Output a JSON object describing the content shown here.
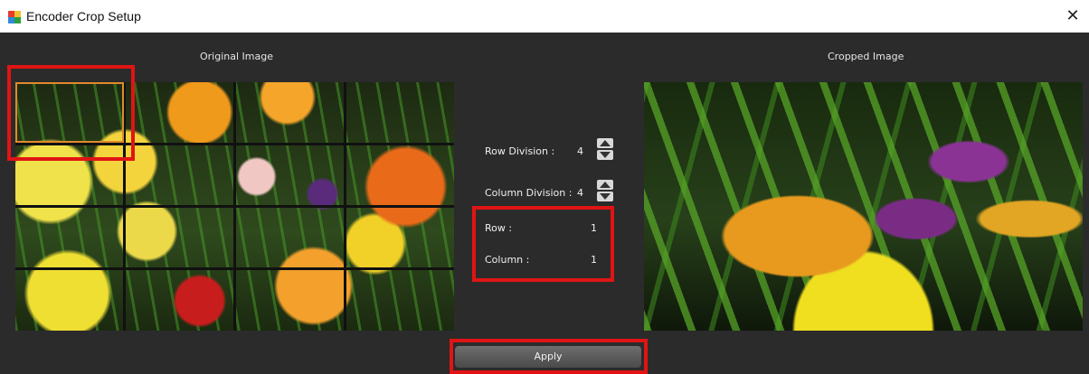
{
  "window": {
    "title": "Encoder Crop Setup",
    "close_glyph": "✕",
    "icon": "app-grid-icon",
    "icon_colors": [
      "#e63b2e",
      "#f2c12e",
      "#2f8ad8",
      "#2e9e3c"
    ]
  },
  "panels": {
    "original_label": "Original Image",
    "cropped_label": "Cropped Image"
  },
  "controls": {
    "row_division_label": "Row Division :",
    "row_division_value": "4",
    "column_division_label": "Column Division :",
    "column_division_value": "4",
    "row_label": "Row :",
    "row_value": "1",
    "column_label": "Column :",
    "column_value": "1"
  },
  "buttons": {
    "apply_label": "Apply"
  },
  "colors": {
    "background": "#2b2b2b",
    "highlight": "#e01414",
    "selection": "#e08a2a"
  }
}
